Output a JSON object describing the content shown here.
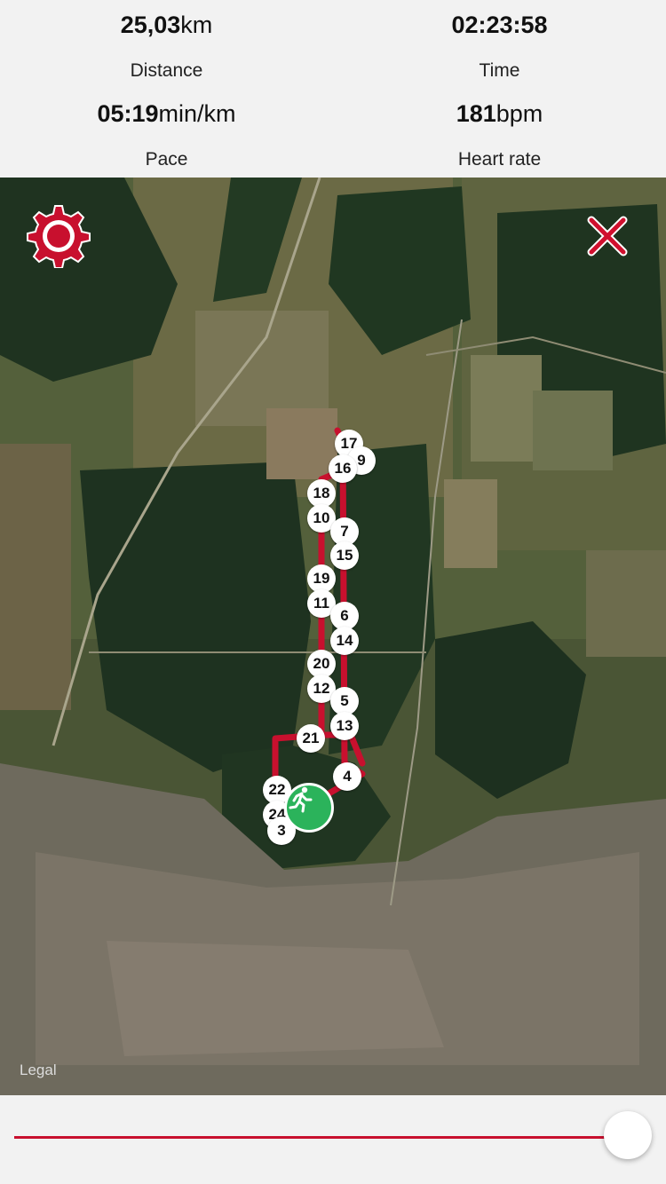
{
  "stats": {
    "distance": {
      "number": "25,03",
      "unit": "km",
      "label": "Distance"
    },
    "time": {
      "number": "02:23:58",
      "unit": "",
      "label": "Time"
    },
    "pace": {
      "number": "05:19",
      "unit": "min/km",
      "label": "Pace"
    },
    "heart_rate": {
      "number": "181",
      "unit": "bpm",
      "label": "Heart rate"
    }
  },
  "map": {
    "legal": "Legal",
    "route_color": "#c8102e",
    "markers": [
      "17",
      "9",
      "16",
      "18",
      "10",
      "7",
      "15",
      "19",
      "11",
      "6",
      "14",
      "20",
      "12",
      "5",
      "13",
      "21",
      "4",
      "22",
      "24",
      "3"
    ]
  },
  "icons": {
    "settings": "gear-icon",
    "close": "close-icon",
    "runner": "runner-icon"
  },
  "slider": {
    "progress": 1.0
  }
}
